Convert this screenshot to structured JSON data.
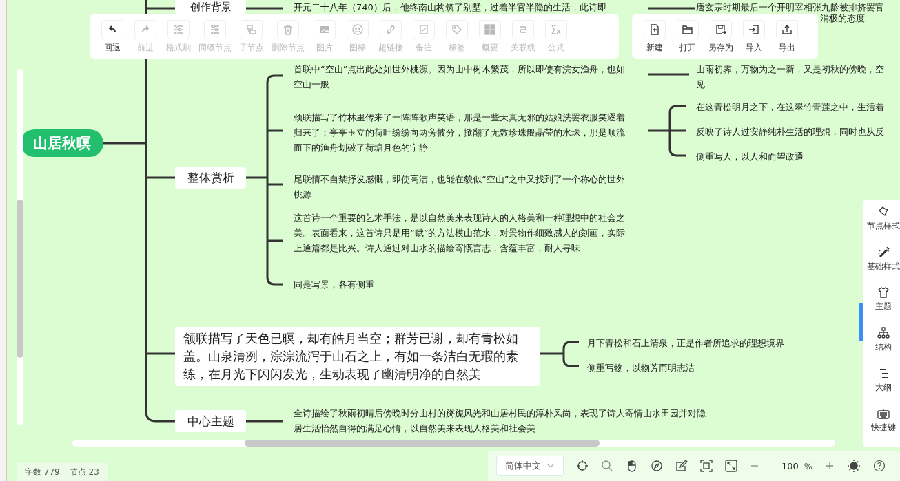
{
  "toolbar": [
    {
      "label": "回退",
      "disabled": false
    },
    {
      "label": "前进",
      "disabled": true
    },
    {
      "label": "格式刷",
      "disabled": true
    },
    {
      "label": "同级节点",
      "disabled": true
    },
    {
      "label": "子节点",
      "disabled": true
    },
    {
      "label": "删除节点",
      "disabled": true
    },
    {
      "label": "图片",
      "disabled": true
    },
    {
      "label": "图标",
      "disabled": true
    },
    {
      "label": "超链接",
      "disabled": true
    },
    {
      "label": "备注",
      "disabled": true
    },
    {
      "label": "标签",
      "disabled": true
    },
    {
      "label": "概要",
      "disabled": true
    },
    {
      "label": "关联线",
      "disabled": true
    },
    {
      "label": "公式",
      "disabled": true
    }
  ],
  "file_toolbar": [
    {
      "label": "新建"
    },
    {
      "label": "打开"
    },
    {
      "label": "另存为"
    },
    {
      "label": "导入"
    },
    {
      "label": "导出"
    }
  ],
  "mindmap": {
    "root": "山居秋暝",
    "branches": [
      {
        "text": "创作背景",
        "children": [
          {
            "text": "开元二十八年（740）后，他终南山构筑了别墅，过着半官半隐的生活，此诗即",
            "children": [
              {
                "lines": [
                  "唐玄宗时期最后一个开明宰相张九龄被排挤罢官",
                  "消极的态度"
                ]
              }
            ]
          }
        ]
      },
      {
        "text": "整体赏析",
        "children": [
          {
            "text": "首联中“空山”点出此处如世外桃源。因为山中树木繁茂，所以即使有浣女渔舟，也如空山一般",
            "children": [
              {
                "lines": [
                  "山雨初霁，万物为之一新，又是初秋的傍晚，空",
                  "见"
                ]
              }
            ]
          },
          {
            "text": "颈联描写了竹林里传来了一阵阵歌声笑语，那是一些天真无邪的姑娘洗罢衣服笑逐着归来了；亭亭玉立的荷叶纷纷向两旁披分，掀翻了无数珍珠般晶莹的水珠，那是顺流而下的渔舟划破了荷塘月色的宁静",
            "children": [
              {
                "lines": [
                  "在这青松明月之下，在这翠竹青莲之中，生活着"
                ]
              },
              {
                "lines": [
                  "反映了诗人过安静纯朴生活的理想，同时也从反"
                ]
              },
              {
                "lines": [
                  "侧重写人，以人和而望政通"
                ]
              }
            ]
          },
          {
            "text": "尾联情不自禁抒发感慨，即使高洁，也能在貌似“空山”之中又找到了一个称心的世外桃源"
          },
          {
            "text": "这首诗一个重要的艺术手法，是以自然美来表现诗人的人格美和一种理想中的社会之美。表面看来，这首诗只是用“赋”的方法模山范水，对景物作细致感人的刻画，实际上通篇都是比兴。诗人通过对山水的描绘寄慨言志，含蕴丰富，耐人寻味"
          },
          {
            "text": "同是写景，各有侧重"
          }
        ]
      },
      {
        "text": "颔联描写了天色已暝，却有皓月当空；群芳已谢，却有青松如盖。山泉清冽，淙淙流泻于山石之上，有如一条洁白无瑕的素练，在月光下闪闪发光，生动表现了幽清明净的自然美",
        "children": [
          {
            "text": "月下青松和石上清泉，正是作者所追求的理想境界"
          },
          {
            "text": "侧重写物，以物芳而明志洁"
          }
        ]
      },
      {
        "text": "中心主题",
        "children": [
          {
            "text": "全诗描绘了秋雨初晴后傍晚时分山村的旖旎风光和山居村民的淳朴风尚，表现了诗人寄情山水田园并对隐居生活怡然自得的满足心情，以自然美来表现人格美和社会美"
          }
        ]
      }
    ]
  },
  "side_panel": [
    {
      "label": "节点样式"
    },
    {
      "label": "基础样式"
    },
    {
      "label": "主题"
    },
    {
      "label": "结构"
    },
    {
      "label": "大纲"
    },
    {
      "label": "快捷键"
    }
  ],
  "status_bar": [
    {
      "text": "字数 779"
    },
    {
      "text": "节点 23"
    }
  ],
  "bottom_bar": {
    "language": "简体中文",
    "zoom": "100",
    "zoom_unit": "%"
  }
}
